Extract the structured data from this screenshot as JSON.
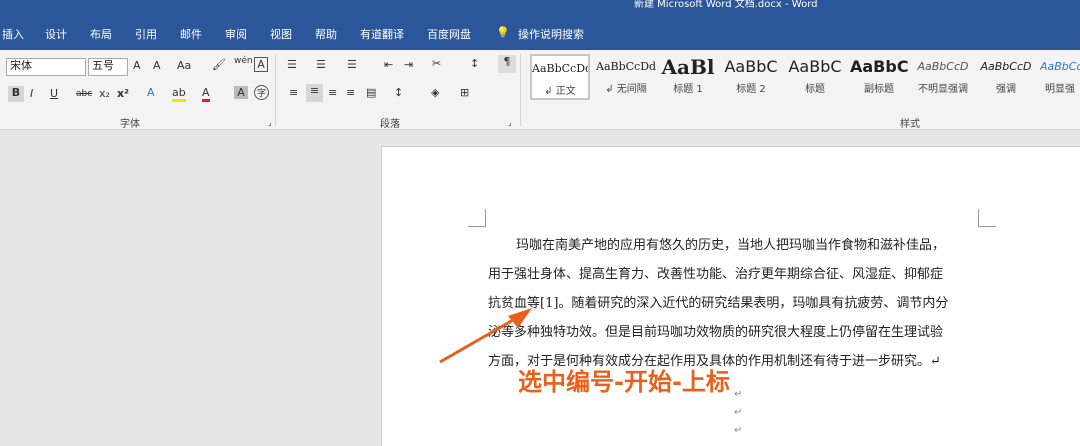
{
  "window": {
    "title": "新建 Microsoft Word 文档.docx  -  Word"
  },
  "menu": [
    "插入",
    "设计",
    "布局",
    "引用",
    "邮件",
    "审阅",
    "视图",
    "帮助",
    "有道翻译",
    "百度网盘",
    "操作说明搜索"
  ],
  "font_group": {
    "font_name": "宋体",
    "font_size": "五号",
    "group_label": "字体",
    "buttons": [
      "A",
      "A",
      "Aa",
      "B",
      "I",
      "U",
      "abc",
      "x₂",
      "x²",
      "A",
      "A",
      "A",
      "A"
    ]
  },
  "paragraph_group": {
    "group_label": "段落"
  },
  "styles_group": {
    "group_label": "样式",
    "styles": [
      {
        "preview": "AaBbCcDd",
        "label": "↲ 正文"
      },
      {
        "preview": "AaBbCcDd",
        "label": "↲ 无间隔"
      },
      {
        "preview": "AaBl",
        "label": "标题 1"
      },
      {
        "preview": "AaBbC",
        "label": "标题 2"
      },
      {
        "preview": "AaBbC",
        "label": "标题"
      },
      {
        "preview": "AaBbC",
        "label": "副标题"
      },
      {
        "preview": "AaBbCcD",
        "label": "不明显强调"
      },
      {
        "preview": "AaBbCcD",
        "label": "强调"
      },
      {
        "preview": "AaBbCcD",
        "label": "明显强"
      }
    ]
  },
  "document": {
    "lines": [
      "玛咖在南美产地的应用有悠久的历史，当地人把玛咖当作食物和滋补佳品，",
      "用于强壮身体、提高生育力、改善性功能、治疗更年期综合征、风湿症、抑郁症",
      "抗贫血等[1]。随着研究的深入近代的研究结果表明，玛咖具有抗疲劳、调节内分",
      "泌等多种独特功效。但是目前玛咖功效物质的研究很大程度上仍停留在生理试验",
      "方面，对于是何种有效成分在起作用及具体的作用机制还有待于进一步研究。↵"
    ],
    "para_marks": [
      "↵",
      "↵",
      "↵"
    ]
  },
  "annotation": {
    "text": "选中编号-开始-上标"
  },
  "colors": {
    "accent": "#2b579a",
    "annotation": "#e8601c"
  }
}
